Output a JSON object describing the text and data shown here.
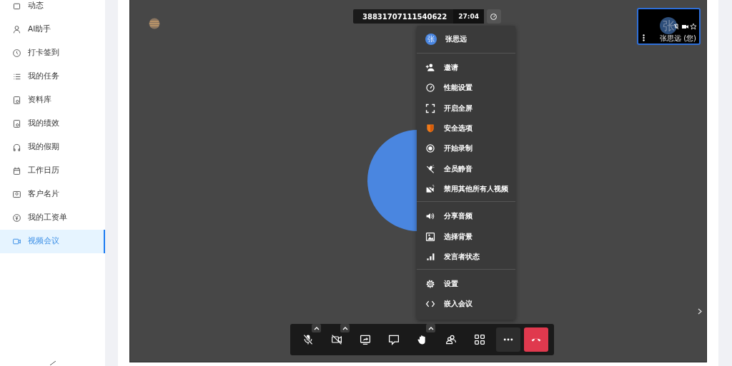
{
  "sidebar": {
    "items": [
      {
        "label": "动态",
        "selected": false
      },
      {
        "label": "AI助手",
        "selected": false
      },
      {
        "label": "打卡签到",
        "selected": false
      },
      {
        "label": "我的任务",
        "selected": false
      },
      {
        "label": "资料库",
        "selected": false
      },
      {
        "label": "我的绩效",
        "selected": false
      },
      {
        "label": "我的假期",
        "selected": false
      },
      {
        "label": "工作日历",
        "selected": false
      },
      {
        "label": "客户名片",
        "selected": false
      },
      {
        "label": "我的工资单",
        "selected": false
      },
      {
        "label": "视频会议",
        "selected": true
      }
    ]
  },
  "meeting": {
    "meeting_id": "38831707111540622",
    "timer": "27:04",
    "self_tile": {
      "avatar": "张",
      "name": "张思远 (您)"
    },
    "menu": {
      "user": {
        "avatar": "张",
        "name": "张思远"
      },
      "groups": [
        [
          {
            "kind": "invite",
            "label": "邀请"
          },
          {
            "kind": "performance",
            "label": "性能设置"
          },
          {
            "kind": "fullscreen",
            "label": "开启全屏"
          },
          {
            "kind": "security",
            "label": "安全选项"
          },
          {
            "kind": "record",
            "label": "开始录制"
          },
          {
            "kind": "mute-all",
            "label": "全员静音"
          },
          {
            "kind": "disable-video",
            "label": "禁用其他所有人视频"
          }
        ],
        [
          {
            "kind": "share-audio",
            "label": "分享音频"
          },
          {
            "kind": "background",
            "label": "选择背景"
          },
          {
            "kind": "speaker-stats",
            "label": "发言者状态"
          }
        ],
        [
          {
            "kind": "settings",
            "label": "设置"
          },
          {
            "kind": "embed",
            "label": "嵌入会议"
          }
        ]
      ]
    },
    "toolbar": [
      {
        "kind": "mic",
        "caret": true
      },
      {
        "kind": "camera",
        "caret": true
      },
      {
        "kind": "share",
        "caret": false
      },
      {
        "kind": "chat",
        "caret": false
      },
      {
        "kind": "hand",
        "caret": true
      },
      {
        "kind": "participants",
        "caret": false
      },
      {
        "kind": "tiles",
        "caret": false
      },
      {
        "kind": "more",
        "caret": false
      },
      {
        "kind": "hangup",
        "caret": false
      }
    ]
  }
}
